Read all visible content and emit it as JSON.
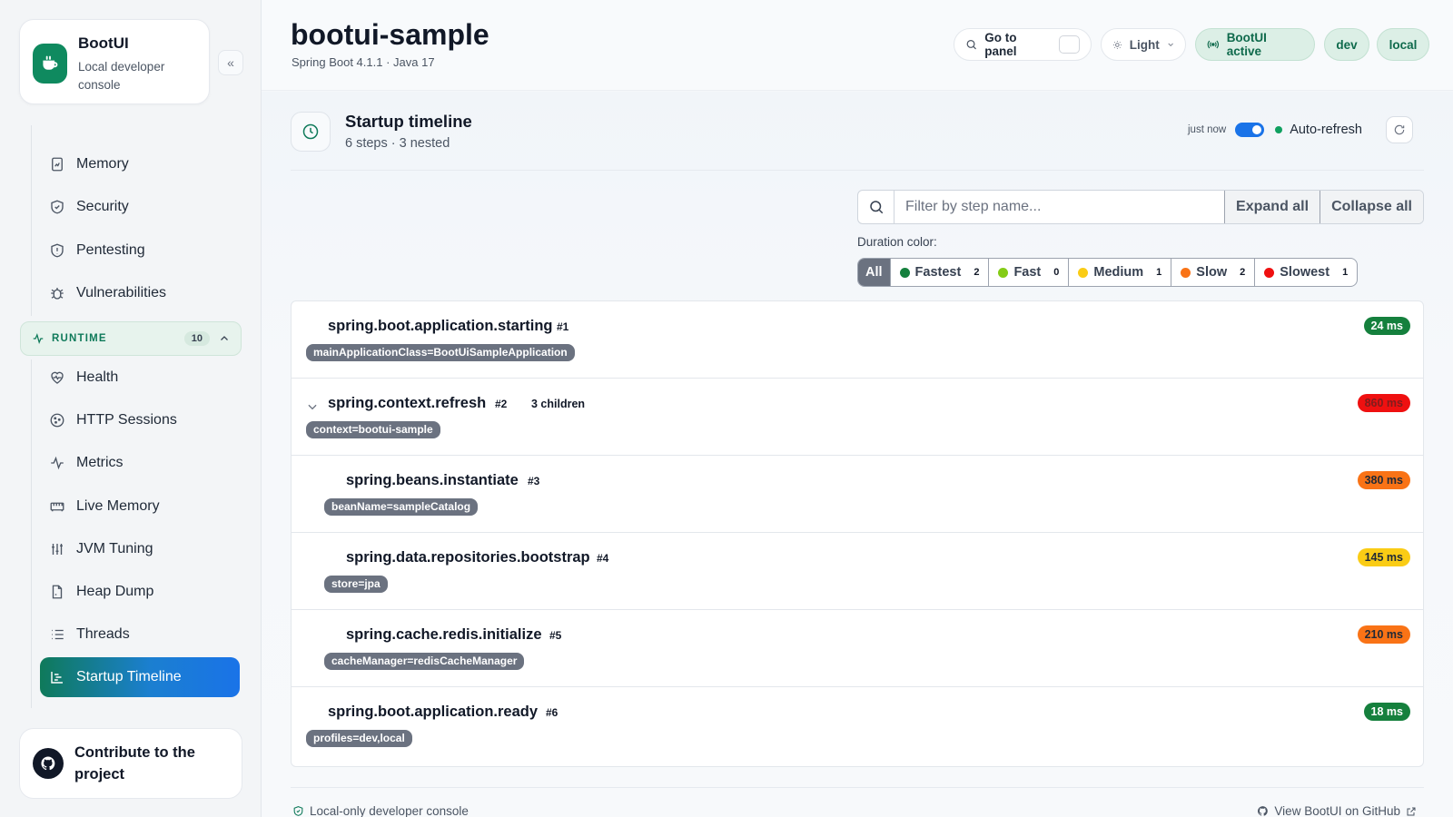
{
  "brand": {
    "name": "BootUI",
    "subtitle": "Local developer console"
  },
  "sidebar": {
    "items_top": [
      {
        "label": "Memory",
        "icon": "memory-icon"
      },
      {
        "label": "Security",
        "icon": "shield-icon"
      },
      {
        "label": "Pentesting",
        "icon": "shield-alert-icon"
      },
      {
        "label": "Vulnerabilities",
        "icon": "bug-icon"
      }
    ],
    "runtime_group": {
      "label": "RUNTIME",
      "count": "10"
    },
    "items_runtime": [
      {
        "label": "Health",
        "icon": "heart-pulse-icon"
      },
      {
        "label": "HTTP Sessions",
        "icon": "cookie-icon"
      },
      {
        "label": "Metrics",
        "icon": "activity-icon"
      },
      {
        "label": "Live Memory",
        "icon": "memory-stick-icon"
      },
      {
        "label": "JVM Tuning",
        "icon": "sliders-icon"
      },
      {
        "label": "Heap Dump",
        "icon": "file-icon"
      },
      {
        "label": "Threads",
        "icon": "list-icon"
      },
      {
        "label": "Startup Timeline",
        "icon": "timeline-icon",
        "active": true
      }
    ],
    "contribute": "Contribute to the project"
  },
  "header": {
    "title": "bootui-sample",
    "subtitle": "Spring Boot 4.1.1 · Java 17",
    "goto_label": "Go to panel",
    "theme_label": "Light",
    "status_label": "BootUI active",
    "env_dev": "dev",
    "env_local": "local"
  },
  "panel": {
    "title": "Startup timeline",
    "subtitle": "6 steps · 3 nested",
    "refresh_time": "just now",
    "auto_refresh_label": "Auto-refresh",
    "auto_refresh_on": true,
    "filter_placeholder": "Filter by step name...",
    "expand_all": "Expand all",
    "collapse_all": "Collapse all",
    "duration_color_label": "Duration color:",
    "duration_filters": [
      {
        "label": "All",
        "color": "",
        "count": ""
      },
      {
        "label": "Fastest",
        "color": "#15803d",
        "count": "2"
      },
      {
        "label": "Fast",
        "color": "#84cc16",
        "count": "0"
      },
      {
        "label": "Medium",
        "color": "#facc15",
        "count": "1"
      },
      {
        "label": "Slow",
        "color": "#f97316",
        "count": "2"
      },
      {
        "label": "Slowest",
        "color": "#ef1010",
        "count": "1"
      }
    ]
  },
  "steps": [
    {
      "name": "spring.boot.application.starting",
      "index": "#1",
      "tag": "mainApplicationClass=BootUiSampleApplication",
      "duration": "24 ms",
      "badge_bg": "#15803d",
      "badge_fg": "#ffffff"
    },
    {
      "name": "spring.context.refresh",
      "index": "#2",
      "children": "3 children",
      "tag": "context=bootui-sample",
      "duration": "860 ms",
      "badge_bg": "#ef1010",
      "badge_fg": "#7f1d1d"
    },
    {
      "name": "spring.beans.instantiate",
      "index": "#3",
      "tag": "beanName=sampleCatalog",
      "duration": "380 ms",
      "badge_bg": "#f97316",
      "badge_fg": "#1f2937"
    },
    {
      "name": "spring.data.repositories.bootstrap",
      "index": "#4",
      "tag": "store=jpa",
      "duration": "145 ms",
      "badge_bg": "#facc15",
      "badge_fg": "#1f2937"
    },
    {
      "name": "spring.cache.redis.initialize",
      "index": "#5",
      "tag": "cacheManager=redisCacheManager",
      "duration": "210 ms",
      "badge_bg": "#f97316",
      "badge_fg": "#1f2937"
    },
    {
      "name": "spring.boot.application.ready",
      "index": "#6",
      "tag": "profiles=dev,local",
      "duration": "18 ms",
      "badge_bg": "#15803d",
      "badge_fg": "#ffffff"
    }
  ],
  "footer": {
    "left": "Local-only developer console",
    "right": "View BootUI on GitHub"
  },
  "colors": {
    "brand_green": "#0f8a5f",
    "accent_blue": "#1a73e8"
  }
}
